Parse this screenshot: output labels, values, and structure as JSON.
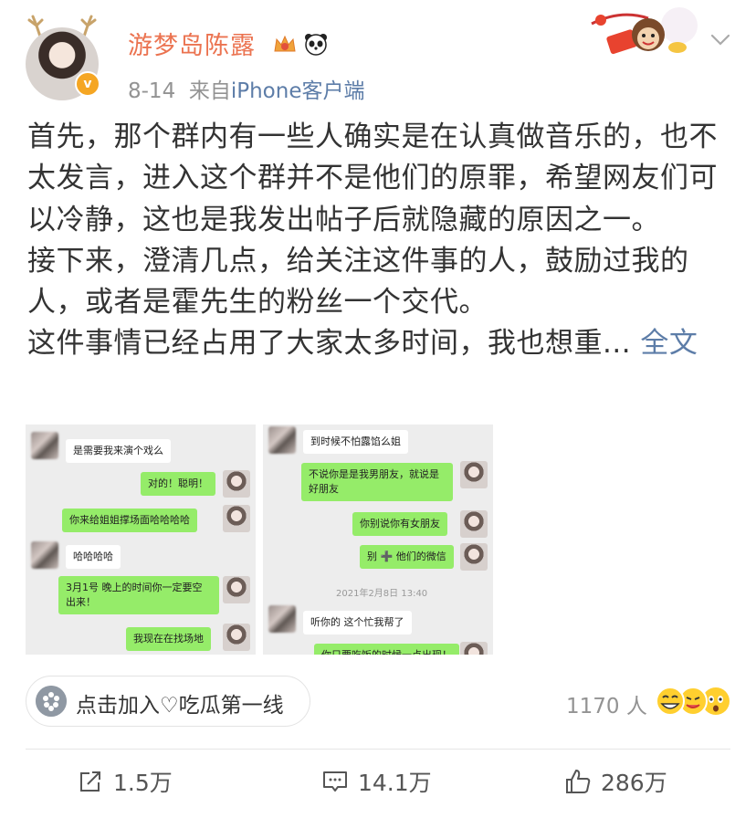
{
  "header": {
    "username": "游梦岛陈露",
    "date": "8-14",
    "source_prefix": "来自",
    "source": "iPhone客户端"
  },
  "post": {
    "paragraphs": [
      "首先，那个群内有一些人确实是在认真做音乐的，也不太发言，进入这个群并不是他们的原罪，希望网友们可以冷静，这也是我发出帖子后就隐藏的原因之一。",
      "接下来，澄清几点，给关注这件事的人，鼓励过我的人，或者是霍先生的粉丝一个交代。"
    ],
    "last_line": "这件事情已经占用了大家太多时间，我也想重...",
    "more_label": "全文"
  },
  "images": {
    "left": {
      "messages": [
        "是需要我来演个戏么",
        "对的！聪明！",
        "你来给姐姐撑场面哈哈哈哈",
        "哈哈哈哈",
        "3月1号 晚上的时间你一定要空出来！",
        "我现在在找场地"
      ]
    },
    "right": {
      "messages": [
        "到时候不怕露馅么姐",
        "不说你是是我男朋友，就说是好朋友",
        "你别说你有女朋友",
        "别 ➕ 他们的微信",
        "听你的 这个忙我帮了",
        "你只要吃饭的时候一点出现！"
      ],
      "timestamp": "2021年2月8日 13:40"
    }
  },
  "footer": {
    "topic_label": "点击加入♡吃瓜第一线",
    "member_count": "1170 人"
  },
  "actions": {
    "repost": "1.5万",
    "comment": "14.1万",
    "like": "286万"
  },
  "colors": {
    "username": "#eb7350",
    "link": "#5d7da8",
    "meta": "#939393",
    "chat_green": "#95ec69"
  }
}
